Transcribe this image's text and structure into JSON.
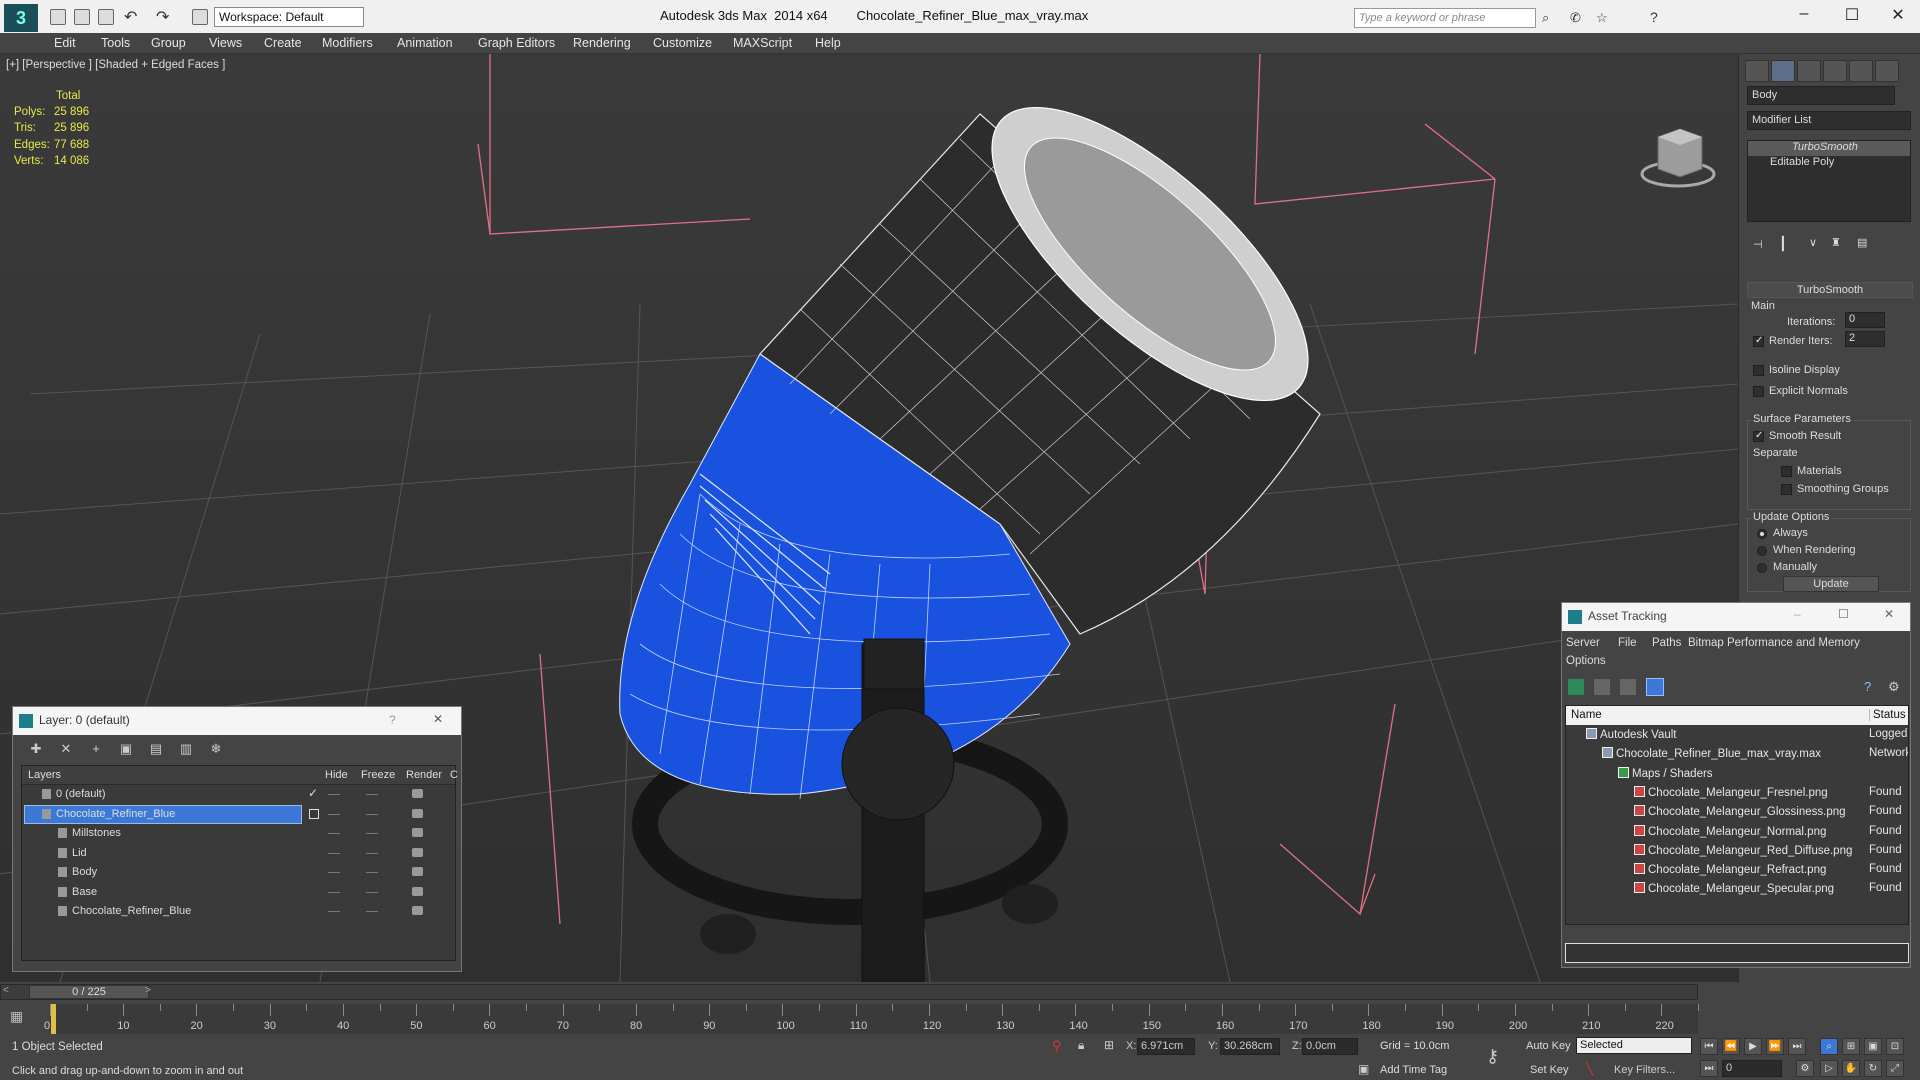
{
  "titlebar": {
    "title": "Autodesk 3ds Max  2014 x64        Chocolate_Refiner_Blue_max_vray.max",
    "workspace": "Workspace: Default",
    "search_placeholder": "Type a keyword or phrase",
    "minimize": "–",
    "maximize": "☐",
    "close": "✕"
  },
  "menu": [
    "Edit",
    "Tools",
    "Group",
    "Views",
    "Create",
    "Modifiers",
    "Animation",
    "Graph Editors",
    "Rendering",
    "Customize",
    "MAXScript",
    "Help"
  ],
  "viewport": {
    "label": "[+] [Perspective ] [Shaded + Edged Faces ]",
    "stats": {
      "header": "Total",
      "rows": [
        {
          "label": "Polys:",
          "value": "25 896"
        },
        {
          "label": "Tris:",
          "value": "25 896"
        },
        {
          "label": "Edges:",
          "value": "77 688"
        },
        {
          "label": "Verts:",
          "value": "14 086"
        }
      ]
    }
  },
  "command_panel": {
    "object_name": "Body",
    "modifier_list": "Modifier List",
    "stack": [
      "TurboSmooth",
      "Editable Poly"
    ],
    "rollout_title": "TurboSmooth",
    "main": "Main",
    "iterations_label": "Iterations:",
    "iterations_value": "0",
    "render_iters_label": "Render Iters:",
    "render_iters_value": "2",
    "isoline": "Isoline Display",
    "explicit_normals": "Explicit Normals",
    "surface_params": "Surface Parameters",
    "smooth_result": "Smooth Result",
    "separate": "Separate",
    "materials": "Materials",
    "smoothing_groups": "Smoothing Groups",
    "update_options": "Update Options",
    "always": "Always",
    "when_rendering": "When Rendering",
    "manually": "Manually",
    "update_button": "Update"
  },
  "layer_dialog": {
    "title": "Layer: 0 (default)",
    "help": "?",
    "close": "✕",
    "columns": {
      "layers": "Layers",
      "hide": "Hide",
      "freeze": "Freeze",
      "render": "Render",
      "c": "C"
    },
    "rows": [
      {
        "name": "0 (default)",
        "indent": 0,
        "selected": false
      },
      {
        "name": "Chocolate_Refiner_Blue",
        "indent": 0,
        "selected": true
      },
      {
        "name": "Millstones",
        "indent": 1,
        "selected": false
      },
      {
        "name": "Lid",
        "indent": 1,
        "selected": false
      },
      {
        "name": "Body",
        "indent": 1,
        "selected": false
      },
      {
        "name": "Base",
        "indent": 1,
        "selected": false
      },
      {
        "name": "Chocolate_Refiner_Blue",
        "indent": 1,
        "selected": false
      }
    ]
  },
  "asset_dialog": {
    "title": "Asset Tracking",
    "menu": [
      "Server",
      "File",
      "Paths",
      "Bitmap Performance and Memory",
      "Options"
    ],
    "columns": {
      "name": "Name",
      "status": "Status"
    },
    "rows": [
      {
        "name": "Autodesk Vault",
        "status": "Logged",
        "indent": 0
      },
      {
        "name": "Chocolate_Refiner_Blue_max_vray.max",
        "status": "Network",
        "indent": 1
      },
      {
        "name": "Maps / Shaders",
        "status": "",
        "indent": 2
      },
      {
        "name": "Chocolate_Melangeur_Fresnel.png",
        "status": "Found",
        "indent": 3
      },
      {
        "name": "Chocolate_Melangeur_Glossiness.png",
        "status": "Found",
        "indent": 3
      },
      {
        "name": "Chocolate_Melangeur_Normal.png",
        "status": "Found",
        "indent": 3
      },
      {
        "name": "Chocolate_Melangeur_Red_Diffuse.png",
        "status": "Found",
        "indent": 3
      },
      {
        "name": "Chocolate_Melangeur_Refract.png",
        "status": "Found",
        "indent": 3
      },
      {
        "name": "Chocolate_Melangeur_Specular.png",
        "status": "Found",
        "indent": 3
      }
    ]
  },
  "timeline": {
    "position": "0 / 225",
    "ticks": [
      "0",
      "10",
      "20",
      "30",
      "40",
      "50",
      "60",
      "70",
      "80",
      "90",
      "100",
      "110",
      "120",
      "130",
      "140",
      "150",
      "160",
      "170",
      "180",
      "190",
      "200",
      "210",
      "220"
    ]
  },
  "status": {
    "selected": "1 Object Selected",
    "prompt": "Click and drag up-and-down to zoom in and out",
    "x_label": "X:",
    "x_value": "6.971cm",
    "y_label": "Y:",
    "y_value": "30.268cm",
    "z_label": "Z:",
    "z_value": "0.0cm",
    "grid": "Grid = 10.0cm",
    "add_time_tag": "Add Time Tag",
    "auto_key": "Auto Key",
    "set_key": "Set Key",
    "selected_dropdown": "Selected",
    "key_filters": "Key Filters...",
    "frame": "0"
  },
  "colors": {
    "accent_blue": "#1a52e0",
    "selection": "#3c78d8",
    "stats_yellow": "#e8e84a",
    "bound_box_pink": "#e0708a"
  }
}
